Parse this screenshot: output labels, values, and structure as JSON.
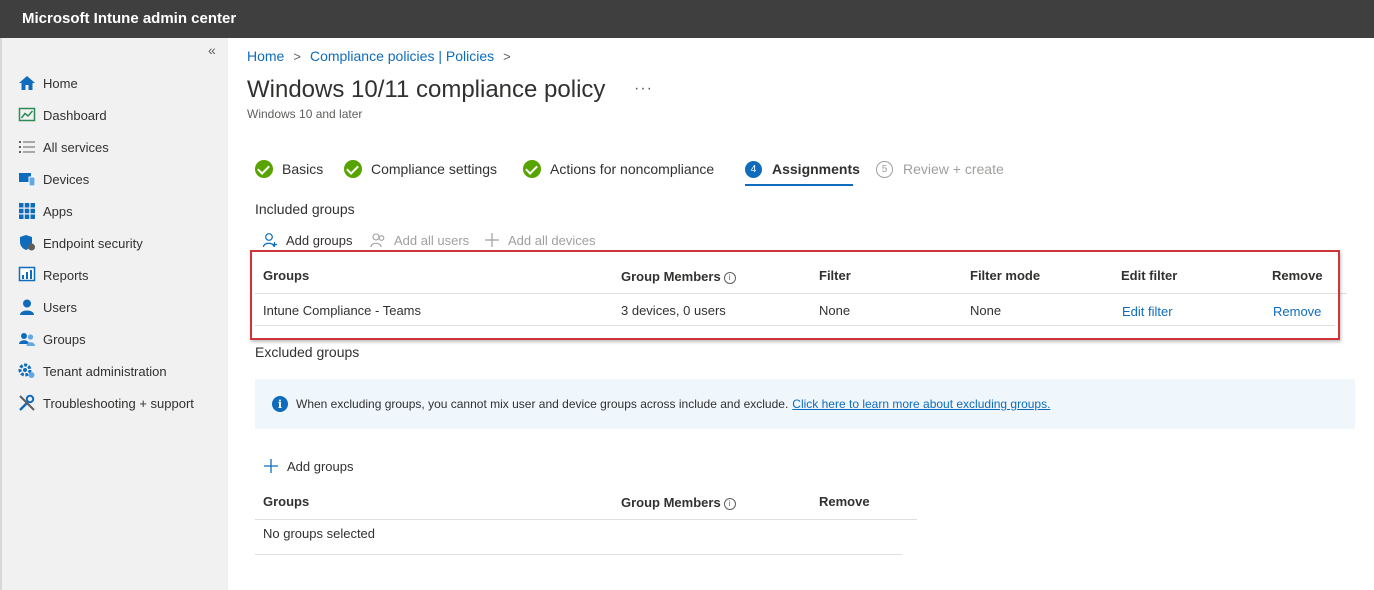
{
  "app": {
    "title": "Microsoft Intune admin center"
  },
  "sidebar": {
    "collapse_glyph": "«",
    "items": [
      {
        "label": "Home",
        "icon": "home-icon"
      },
      {
        "label": "Dashboard",
        "icon": "dashboard-icon"
      },
      {
        "label": "All services",
        "icon": "list-icon"
      },
      {
        "label": "Devices",
        "icon": "devices-icon"
      },
      {
        "label": "Apps",
        "icon": "apps-grid-icon"
      },
      {
        "label": "Endpoint security",
        "icon": "shield-icon"
      },
      {
        "label": "Reports",
        "icon": "reports-icon"
      },
      {
        "label": "Users",
        "icon": "user-icon"
      },
      {
        "label": "Groups",
        "icon": "groups-icon"
      },
      {
        "label": "Tenant administration",
        "icon": "gear-icon"
      },
      {
        "label": "Troubleshooting + support",
        "icon": "wrench-icon"
      }
    ]
  },
  "breadcrumb": {
    "home": "Home",
    "policies": "Compliance policies | Policies",
    "sep": ">"
  },
  "page": {
    "title": "Windows 10/11 compliance policy",
    "subtitle": "Windows 10 and later",
    "more": "···"
  },
  "wizard": {
    "steps": [
      {
        "label": "Basics",
        "state": "complete"
      },
      {
        "label": "Compliance settings",
        "state": "complete"
      },
      {
        "label": "Actions for noncompliance",
        "state": "complete"
      },
      {
        "label": "Assignments",
        "state": "active",
        "number": "4"
      },
      {
        "label": "Review + create",
        "state": "disabled",
        "number": "5"
      }
    ]
  },
  "included": {
    "heading": "Included groups",
    "commands": {
      "add_groups": "Add groups",
      "add_all_users": "Add all users",
      "add_all_devices": "Add all devices"
    },
    "columns": {
      "groups": "Groups",
      "members": "Group Members",
      "filter": "Filter",
      "filter_mode": "Filter mode",
      "edit_filter": "Edit filter",
      "remove": "Remove"
    },
    "rows": [
      {
        "group": "Intune Compliance - Teams",
        "members": "3 devices, 0 users",
        "filter": "None",
        "filter_mode": "None",
        "edit_filter": "Edit filter",
        "remove": "Remove"
      }
    ]
  },
  "excluded": {
    "heading": "Excluded groups",
    "info_text": "When excluding groups, you cannot mix user and device groups across include and exclude.",
    "info_link": "Click here to learn more about excluding groups.",
    "add_groups": "Add groups",
    "columns": {
      "groups": "Groups",
      "members": "Group Members",
      "remove": "Remove"
    },
    "empty": "No groups selected"
  },
  "colors": {
    "accent": "#0f6cbd",
    "success": "#57a300",
    "highlight": "#d13438",
    "topbar": "#403f3f"
  }
}
